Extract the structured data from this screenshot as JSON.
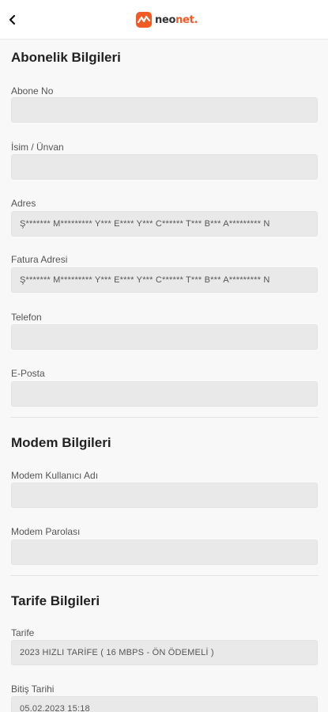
{
  "header": {
    "back_icon": "chevron-left-icon",
    "logo_icon": "neonet-logo-icon",
    "logo_text_dark": "neo",
    "logo_text_accent": "net.",
    "brand_color": "#f15a24"
  },
  "subscription": {
    "title": "Abonelik Bilgileri",
    "fields": [
      {
        "label": "Abone No",
        "value": ""
      },
      {
        "label": "İsim / Ünvan",
        "value": ""
      },
      {
        "label": "Adres",
        "value": "Ş******* M********* Y*** E**** Y*** C****** T*** B*** A********* N"
      },
      {
        "label": "Fatura Adresi",
        "value": "Ş******* M********* Y*** E**** Y*** C****** T*** B*** A********* N"
      },
      {
        "label": "Telefon",
        "value": ""
      },
      {
        "label": "E-Posta",
        "value": ""
      }
    ]
  },
  "modem": {
    "title": "Modem Bilgileri",
    "fields": [
      {
        "label": "Modem Kullanıcı Adı",
        "value": ""
      },
      {
        "label": "Modem Parolası",
        "value": ""
      }
    ]
  },
  "tariff": {
    "title": "Tarife Bilgileri",
    "fields": [
      {
        "label": "Tarife",
        "value": "2023 HIZLI TARİFE ( 16 MBPS - ÖN ÖDEMELİ )"
      },
      {
        "label": "Bitiş Tarihi",
        "value": "05.02.2023 15:18"
      }
    ]
  }
}
